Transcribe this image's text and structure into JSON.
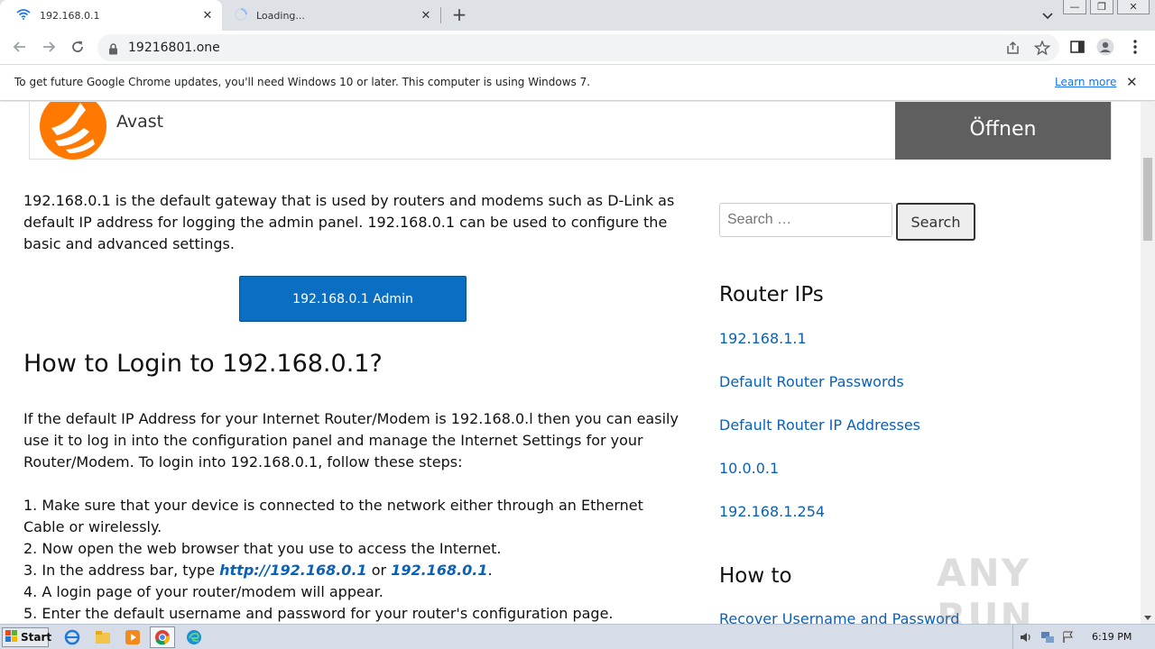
{
  "browser": {
    "tabs": [
      {
        "title": "192.168.0.1",
        "icon": "wifi-icon",
        "active": true
      },
      {
        "title": "Loading...",
        "icon": "loading-spinner-icon",
        "active": false
      }
    ],
    "url": "19216801.one",
    "infobar": {
      "message": "To get future Google Chrome updates, you'll need Windows 10 or later. This computer is using Windows 7.",
      "link": "Learn more"
    }
  },
  "ad": {
    "brand": "Avast",
    "button": "Öffnen"
  },
  "article": {
    "intro": "192.168.0.1 is the default gateway that is used by routers and modems such as D-Link as default IP address for logging the admin panel. 192.168.0.1 can be used to configure the basic and advanced settings.",
    "admin_button": "192.168.0.1 Admin",
    "heading": "How to Login to 192.168.0.1?",
    "para": "If the default IP Address for your Internet Router/Modem is 192.168.0.l then you can easily use it to log in into the configuration panel and manage the Internet Settings for your Router/Modem. To login into 192.168.0.1, follow these steps:",
    "steps": {
      "s1": "1. Make sure that your device is connected to the network either through an Ethernet Cable or wirelessly.",
      "s2": "2. Now open the web browser that you use to access the Internet.",
      "s3_prefix": "3. In the address bar, type ",
      "s3_link1": "http://192.168.0.1",
      "s3_or": " or ",
      "s3_link2": "192.168.0.1",
      "s3_end": ".",
      "s4": "4. A login page of your router/modem will appear.",
      "s5": "5. Enter the default username and password for your router's configuration page."
    }
  },
  "sidebar": {
    "search_placeholder": "Search …",
    "search_button": "Search",
    "router_ips_heading": "Router IPs",
    "router_links": [
      "192.168.1.1",
      "Default Router Passwords",
      "Default Router IP Addresses",
      "10.0.0.1",
      "192.168.1.254"
    ],
    "howto_heading": "How to",
    "howto_links": [
      "Recover Username and Password"
    ]
  },
  "watermark": "ANY RUN",
  "taskbar": {
    "start": "Start",
    "clock": "6:19 PM"
  }
}
